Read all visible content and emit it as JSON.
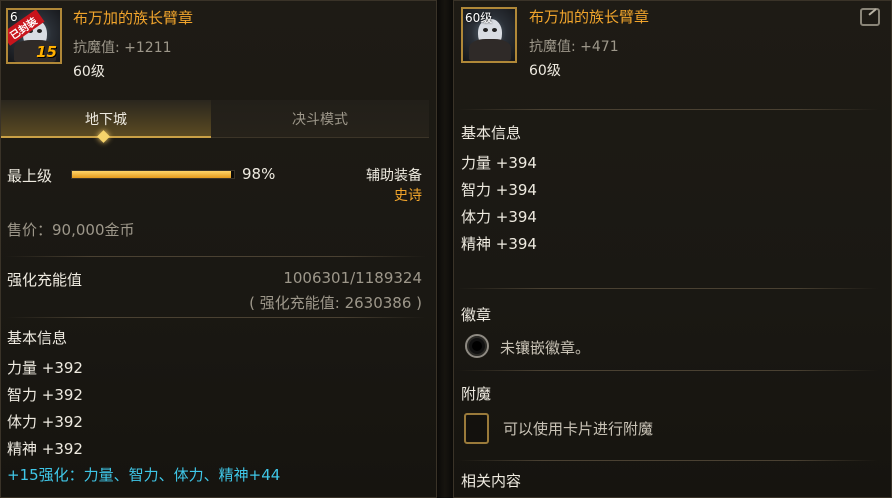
{
  "left": {
    "item": {
      "name": "布万加的族长臂章",
      "resist": "抗魔值: +1211",
      "level": "60级",
      "icon_level": "6",
      "enhance": "15",
      "badge": "已封装"
    },
    "tabs": [
      {
        "label": "地下城"
      },
      {
        "label": "决斗模式"
      }
    ],
    "grade": {
      "label": "最上级",
      "percent": "98%",
      "fill_fraction": 0.98
    },
    "type": {
      "label": "辅助装备",
      "rarity": "史诗"
    },
    "price": "售价：90,000金币",
    "charge": {
      "label": "强化充能值",
      "value": "1006301/1189324",
      "total": "( 强化充能值: 2630386 )"
    },
    "basic_title": "基本信息",
    "stats": [
      "力量 +392",
      "智力 +392",
      "体力 +392",
      "精神 +392"
    ],
    "bonus": "+15强化：力量、智力、体力、精神+44"
  },
  "right": {
    "item": {
      "name": "布万加的族长臂章",
      "resist": "抗魔值: +471",
      "level": "60级",
      "icon_level": "60级"
    },
    "basic_title": "基本信息",
    "stats": [
      "力量 +394",
      "智力 +394",
      "体力 +394",
      "精神 +394"
    ],
    "emblem": {
      "title": "徽章",
      "text": "未镶嵌徽章。"
    },
    "enchant": {
      "title": "附魔",
      "text": "可以使用卡片进行附魔"
    },
    "related": "相关内容"
  },
  "colors": {
    "gold": "#f0a42c",
    "cyan": "#3fc7e8",
    "text": "#eeeae0",
    "grey": "#9d978a"
  }
}
